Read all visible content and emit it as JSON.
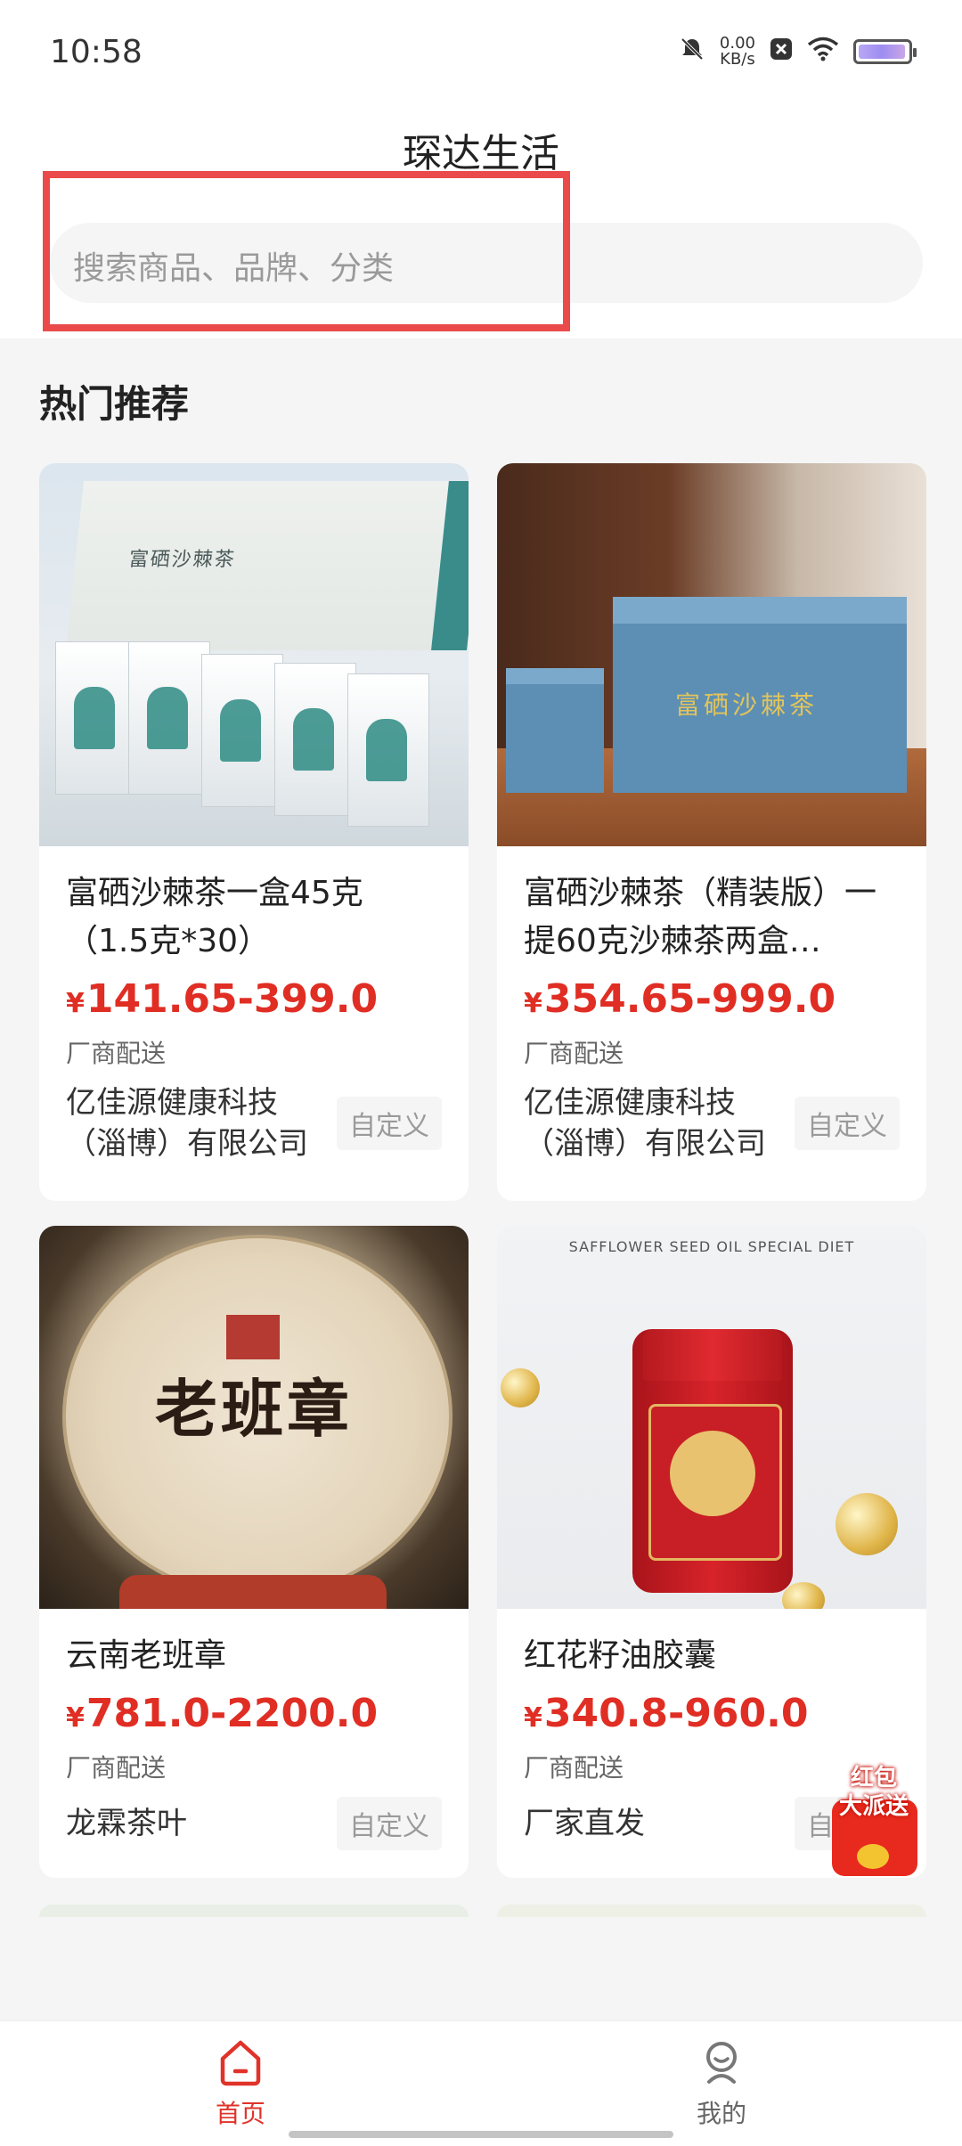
{
  "status_bar": {
    "time": "10:58",
    "net_speed_value": "0.00",
    "net_speed_unit": "KB/s",
    "icons": [
      "mute-bell-icon",
      "data-x-icon",
      "wifi-icon",
      "battery-icon"
    ]
  },
  "header": {
    "title": "琛达生活",
    "search_placeholder": "搜索商品、品牌、分类"
  },
  "section": {
    "title": "热门推荐"
  },
  "products": [
    {
      "title": "富硒沙棘茶一盒45克（1.5克*30）",
      "currency": "¥",
      "price": "141.65-399.0",
      "delivery": "厂商配送",
      "seller": "亿佳源健康科技（淄博）有限公司",
      "tag": "自定义",
      "image_box_text": "富硒沙棘茶"
    },
    {
      "title": "富硒沙棘茶（精装版）一提60克沙棘茶两盒…",
      "currency": "¥",
      "price": "354.65-999.0",
      "delivery": "厂商配送",
      "seller": "亿佳源健康科技（淄博）有限公司",
      "tag": "自定义",
      "image_box_text": "富硒沙棘茶"
    },
    {
      "title": "云南老班章",
      "currency": "¥",
      "price": "781.0-2200.0",
      "delivery": "厂商配送",
      "seller": "龙霖茶叶",
      "tag": "自定义",
      "image_cake_text": "老班章"
    },
    {
      "title": "红花籽油胶囊",
      "currency": "¥",
      "price": "340.8-960.0",
      "delivery": "厂商配送",
      "seller": "厂家直发",
      "tag": "自定义",
      "image_caption": "SAFFLOWER SEED OIL SPECIAL DIET"
    }
  ],
  "floating_badge": {
    "line1": "红包",
    "line2": "大派送"
  },
  "bottom_nav": {
    "items": [
      {
        "label": "首页",
        "icon": "home-icon",
        "active": true
      },
      {
        "label": "我的",
        "icon": "profile-icon",
        "active": false
      }
    ]
  },
  "colors": {
    "accent": "#e0332a",
    "price": "#e02e24",
    "highlight_border": "#ea4a4a"
  }
}
